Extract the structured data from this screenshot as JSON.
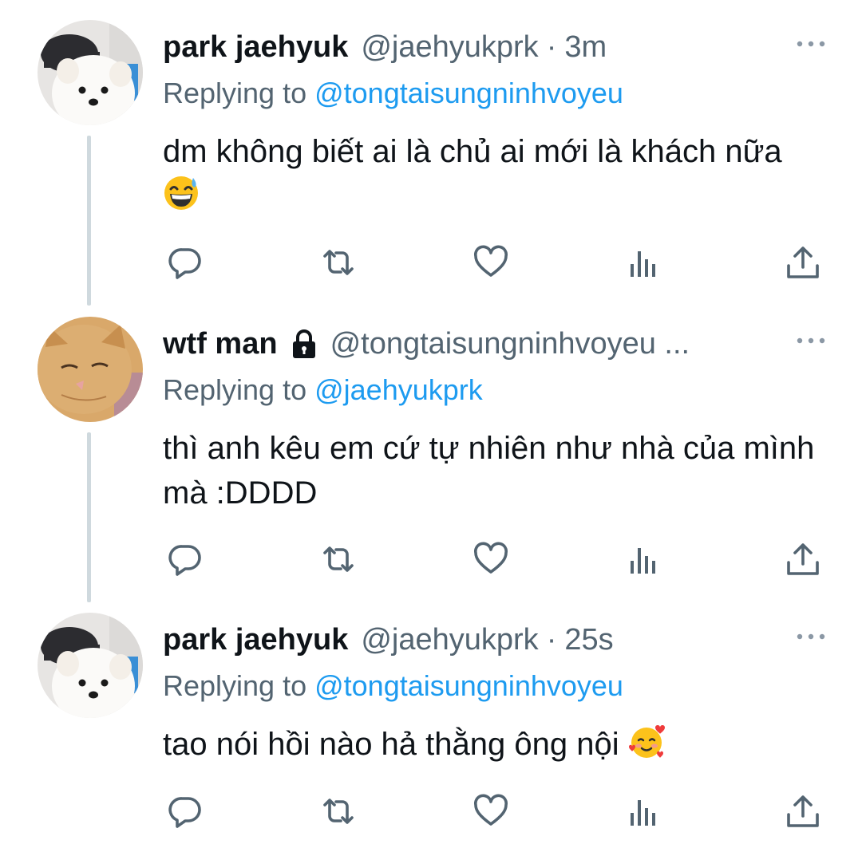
{
  "tweets": [
    {
      "name": "park jaehyuk",
      "handle": "@jaehyukprk",
      "separator": "·",
      "time": "3m",
      "locked": false,
      "replying_prefix": "Replying to ",
      "replying_to": "@tongtaisungninhvoyeu",
      "text": "dm không biết ai là chủ ai mới là khách nữa",
      "emoji": "grinning-sweat-emoji",
      "avatar": "white-dog-avatar"
    },
    {
      "name": "wtf man",
      "handle": "@tongtaisungninhvoyeu ...",
      "separator": "",
      "time": "",
      "locked": true,
      "replying_prefix": "Replying to ",
      "replying_to": "@jaehyukprk",
      "text": "thì anh kêu em cứ tự nhiên như nhà của mình mà :DDDD",
      "emoji": "",
      "avatar": "orange-cat-avatar"
    },
    {
      "name": "park jaehyuk",
      "handle": "@jaehyukprk",
      "separator": "·",
      "time": "25s",
      "locked": false,
      "replying_prefix": "Replying to ",
      "replying_to": "@tongtaisungninhvoyeu",
      "text": "tao nói hồi nào hả thằng ông nội",
      "emoji": "smiling-hearts-emoji",
      "avatar": "white-dog-avatar"
    }
  ],
  "icons": {
    "reply": "reply-icon",
    "retweet": "retweet-icon",
    "like": "like-icon",
    "views": "views-icon",
    "share": "share-icon",
    "more": "more-icon",
    "lock": "lock-icon"
  },
  "colors": {
    "text": "#0f1419",
    "secondary": "#536471",
    "accent": "#1d9bf0",
    "thread_line": "#cfd9de"
  }
}
